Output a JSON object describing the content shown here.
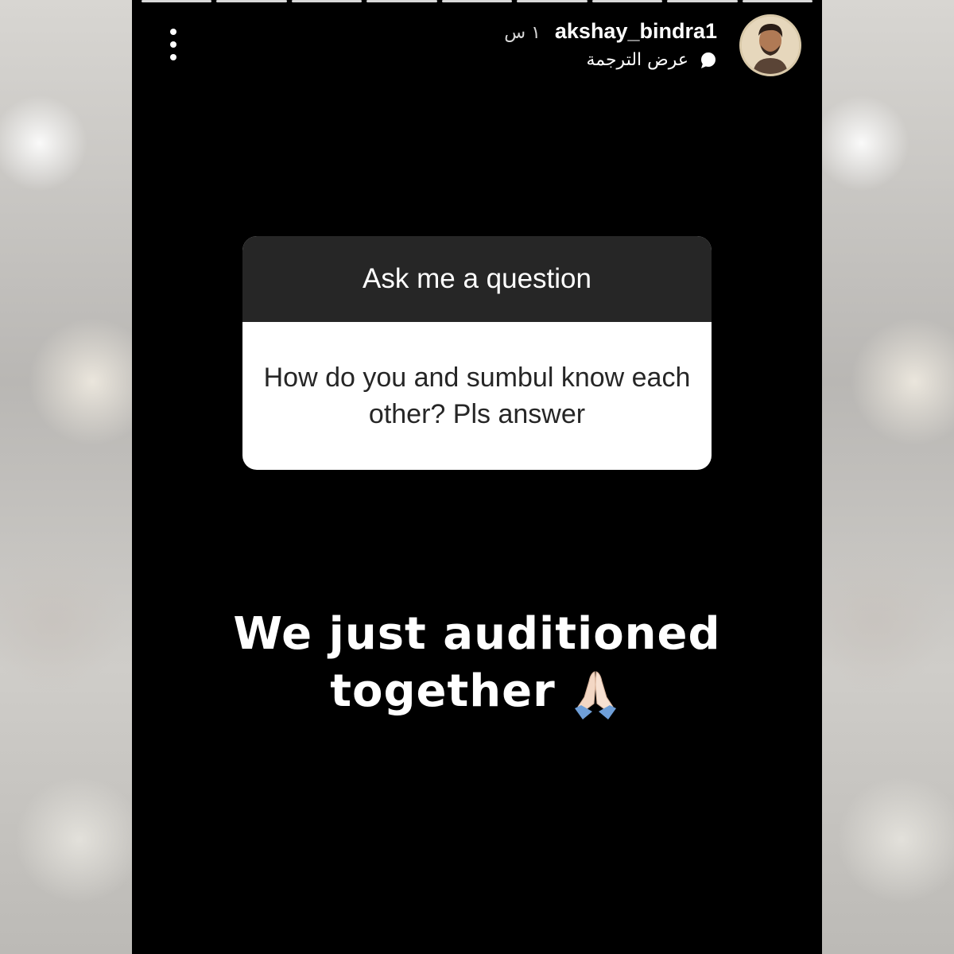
{
  "story": {
    "progress_segments": 9,
    "active_segment": 9,
    "username": "akshay_bindra1",
    "time_ago": "١ س",
    "translate_label": "عرض الترجمة",
    "avatar_icon": "profile-photo"
  },
  "question_sticker": {
    "title": "Ask me a question",
    "question": "How do you and sumbul know each other? Pls answer"
  },
  "answer": {
    "line1": "We just auditioned",
    "line2": "together",
    "emoji": "folded-hands"
  },
  "colors": {
    "story_bg": "#000000",
    "sticker_header": "#262626",
    "sticker_body": "#ffffff"
  }
}
